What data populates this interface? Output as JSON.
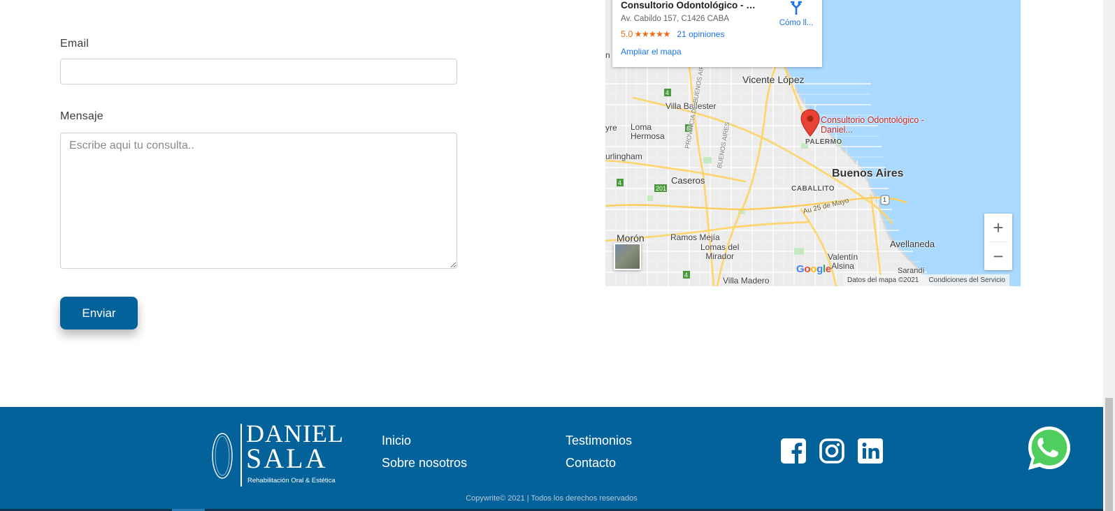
{
  "form": {
    "email_label": "Email",
    "email_value": "",
    "message_label": "Mensaje",
    "message_placeholder": "Escribe aqui tu consulta..",
    "submit_label": "Enviar"
  },
  "map": {
    "place_name": "Consultorio Odontológico - Da...",
    "address": "Av. Cabildo 157, C1426 CABA",
    "rating": "5.0",
    "stars": "★★★★★",
    "reviews": "21 opiniones",
    "enlarge_link": "Ampliar el mapa",
    "directions_label": "Cómo ll...",
    "pin_label": "Consultorio Odontológico - Daniel...",
    "labels": {
      "vicente_lopez": "Vicente López",
      "villa_ballester": "Villa Ballester",
      "loma_hermosa": "Loma\nHermosa",
      "hurlingham": "urlingham",
      "caseros": "Caseros",
      "palermo": "PALERMO",
      "buenos_aires": "Buenos Aires",
      "caballito": "CABALLITO",
      "moron": "Morón",
      "ramos_mejia": "Ramos Mejía",
      "lomas_del_mirador": "Lomas del\nMirador",
      "avellaneda": "Avellaneda",
      "valentin_alsina": "Valentín\nAlsina",
      "sarandi": "Sarandí",
      "villa_madero": "Villa Madero",
      "au_25_mayo": "Au 25 de Mayo",
      "prov_bs_as": "PROVINCIA DE BUENOS AIRES",
      "bs_as_road": "BUENOS AIRES",
      "left_edge": "yre",
      "left_edge2": "n T",
      "route_4a": "4",
      "route_8": "8",
      "route_201": "201",
      "route_4b": "4",
      "route_4c": "4",
      "route_1": "1"
    },
    "google_logo": "Google",
    "map_data": "Datos del mapa ©2021",
    "terms": "Condiciones del Servicio",
    "zoom_in": "+",
    "zoom_out": "−"
  },
  "footer": {
    "logo_line1": "DANIEL",
    "logo_line2": "SALA",
    "logo_sub": "Rehabilitación Oral & Estética",
    "nav": {
      "inicio": "Inicio",
      "sobre": "Sobre nosotros",
      "testimonios": "Testimonios",
      "contacto": "Contacto"
    },
    "copyright": "Copywrite© 2021 | Todos los derechos reservados",
    "colors": {
      "background": "#03629a",
      "button": "#03629a",
      "whatsapp": "#4fce5d"
    },
    "icons": [
      "facebook-icon",
      "instagram-icon",
      "linkedin-icon",
      "whatsapp-icon"
    ]
  }
}
